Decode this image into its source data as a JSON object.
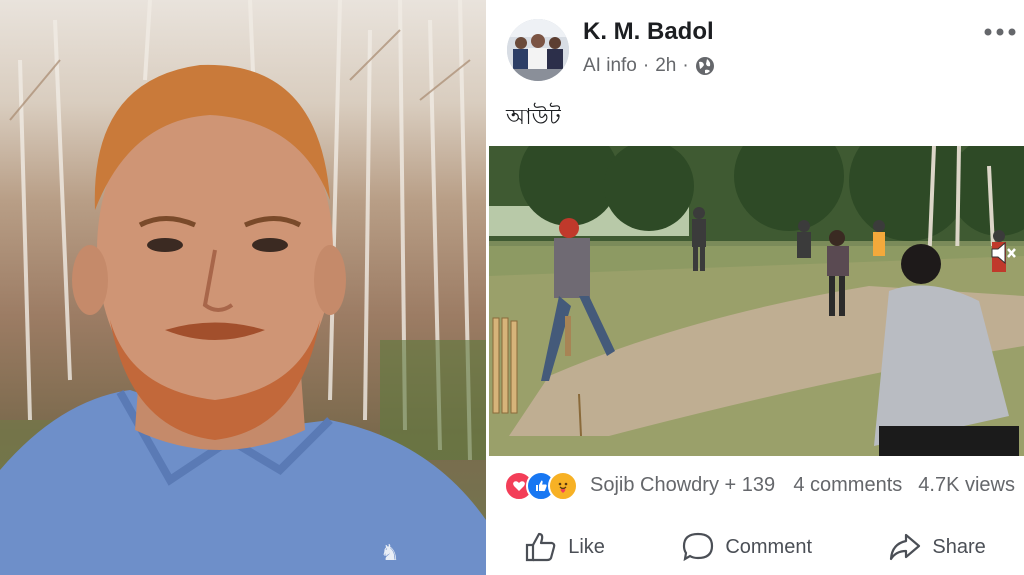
{
  "post": {
    "author": "K. M. Badol",
    "meta_text": "AI info",
    "separator": "·",
    "time": "2h",
    "body_text": "আউট",
    "reactors_label": "Sojib Chowdry + 139",
    "comments_label": "4 comments",
    "views_label": "4.7K views"
  },
  "actions": {
    "like": "Like",
    "comment": "Comment",
    "share": "Share"
  },
  "icons": {
    "more": "more-dots-icon",
    "privacy": "globe-icon",
    "mute": "muted-speaker-icon",
    "like": "thumbs-up-icon",
    "comment": "speech-bubble-icon",
    "share": "share-arrow-icon"
  },
  "colors": {
    "name_text": "#1c1e21",
    "meta_text": "#65676b",
    "love": "#f33e58",
    "like": "#1877f2",
    "care": "#f7b125"
  }
}
